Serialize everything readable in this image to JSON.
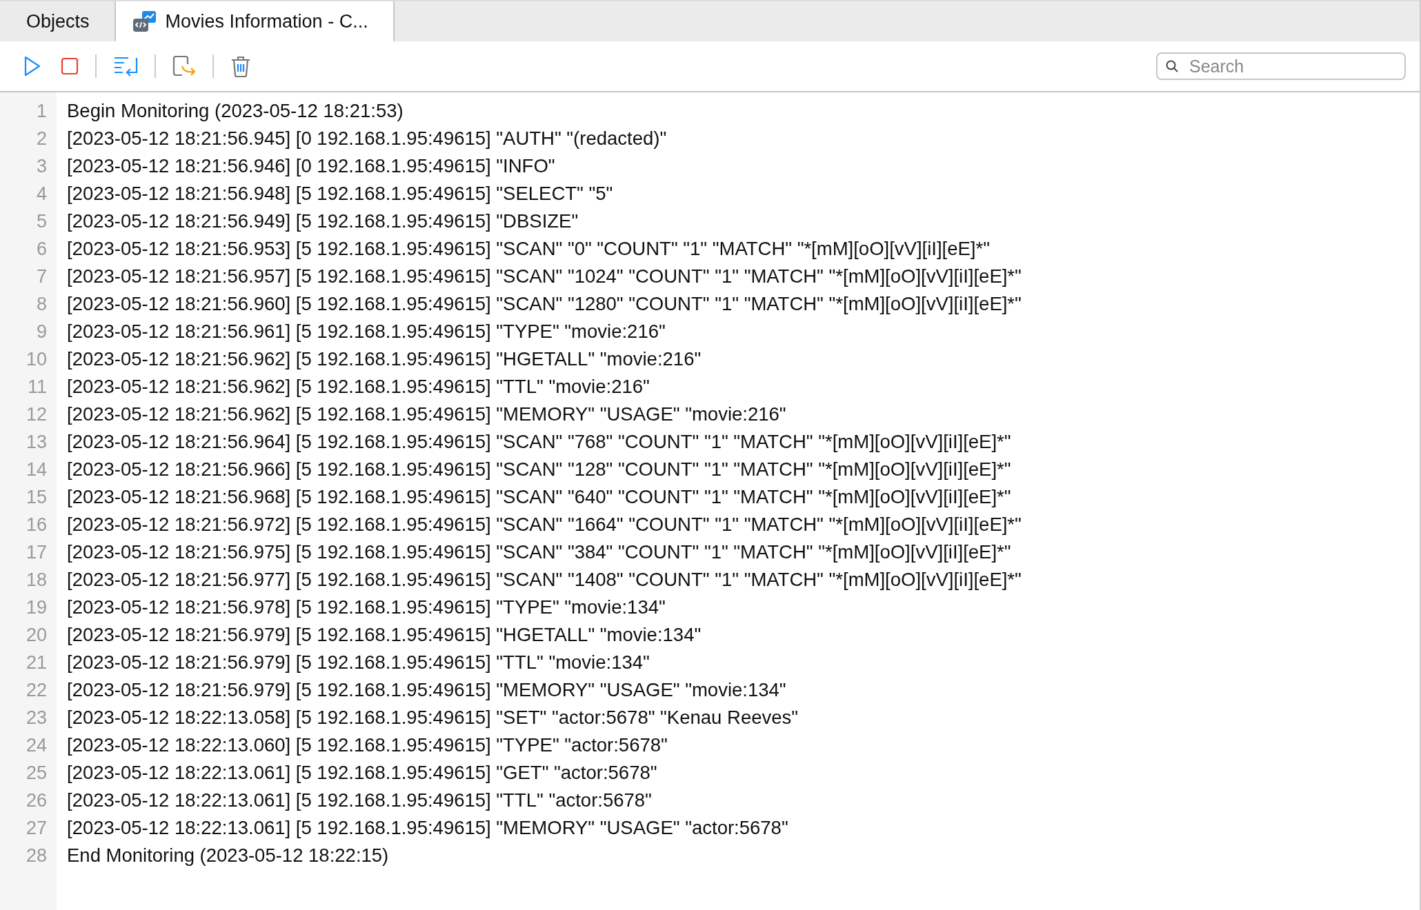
{
  "tabs": [
    {
      "label": "Objects",
      "selected": false,
      "kind": "plain"
    },
    {
      "label": "Movies Information - C...",
      "selected": true,
      "kind": "query"
    }
  ],
  "toolbar": {
    "search": {
      "placeholder": "Search"
    }
  },
  "log": {
    "lines": [
      {
        "number": "1",
        "text": "Begin Monitoring (2023-05-12 18:21:53)"
      },
      {
        "number": "2",
        "text": "[2023-05-12 18:21:56.945] [0 192.168.1.95:49615] \"AUTH\" \"(redacted)\""
      },
      {
        "number": "3",
        "text": "[2023-05-12 18:21:56.946] [0 192.168.1.95:49615] \"INFO\""
      },
      {
        "number": "4",
        "text": "[2023-05-12 18:21:56.948] [5 192.168.1.95:49615] \"SELECT\" \"5\""
      },
      {
        "number": "5",
        "text": "[2023-05-12 18:21:56.949] [5 192.168.1.95:49615] \"DBSIZE\""
      },
      {
        "number": "6",
        "text": "[2023-05-12 18:21:56.953] [5 192.168.1.95:49615] \"SCAN\" \"0\" \"COUNT\" \"1\" \"MATCH\" \"*[mM][oO][vV][iI][eE]*\""
      },
      {
        "number": "7",
        "text": "[2023-05-12 18:21:56.957] [5 192.168.1.95:49615] \"SCAN\" \"1024\" \"COUNT\" \"1\" \"MATCH\" \"*[mM][oO][vV][iI][eE]*\""
      },
      {
        "number": "8",
        "text": "[2023-05-12 18:21:56.960] [5 192.168.1.95:49615] \"SCAN\" \"1280\" \"COUNT\" \"1\" \"MATCH\" \"*[mM][oO][vV][iI][eE]*\""
      },
      {
        "number": "9",
        "text": "[2023-05-12 18:21:56.961] [5 192.168.1.95:49615] \"TYPE\" \"movie:216\""
      },
      {
        "number": "10",
        "text": "[2023-05-12 18:21:56.962] [5 192.168.1.95:49615] \"HGETALL\" \"movie:216\""
      },
      {
        "number": "11",
        "text": "[2023-05-12 18:21:56.962] [5 192.168.1.95:49615] \"TTL\" \"movie:216\""
      },
      {
        "number": "12",
        "text": "[2023-05-12 18:21:56.962] [5 192.168.1.95:49615] \"MEMORY\" \"USAGE\" \"movie:216\""
      },
      {
        "number": "13",
        "text": "[2023-05-12 18:21:56.964] [5 192.168.1.95:49615] \"SCAN\" \"768\" \"COUNT\" \"1\" \"MATCH\" \"*[mM][oO][vV][iI][eE]*\""
      },
      {
        "number": "14",
        "text": "[2023-05-12 18:21:56.966] [5 192.168.1.95:49615] \"SCAN\" \"128\" \"COUNT\" \"1\" \"MATCH\" \"*[mM][oO][vV][iI][eE]*\""
      },
      {
        "number": "15",
        "text": "[2023-05-12 18:21:56.968] [5 192.168.1.95:49615] \"SCAN\" \"640\" \"COUNT\" \"1\" \"MATCH\" \"*[mM][oO][vV][iI][eE]*\""
      },
      {
        "number": "16",
        "text": "[2023-05-12 18:21:56.972] [5 192.168.1.95:49615] \"SCAN\" \"1664\" \"COUNT\" \"1\" \"MATCH\" \"*[mM][oO][vV][iI][eE]*\""
      },
      {
        "number": "17",
        "text": "[2023-05-12 18:21:56.975] [5 192.168.1.95:49615] \"SCAN\" \"384\" \"COUNT\" \"1\" \"MATCH\" \"*[mM][oO][vV][iI][eE]*\""
      },
      {
        "number": "18",
        "text": "[2023-05-12 18:21:56.977] [5 192.168.1.95:49615] \"SCAN\" \"1408\" \"COUNT\" \"1\" \"MATCH\" \"*[mM][oO][vV][iI][eE]*\""
      },
      {
        "number": "19",
        "text": "[2023-05-12 18:21:56.978] [5 192.168.1.95:49615] \"TYPE\" \"movie:134\""
      },
      {
        "number": "20",
        "text": "[2023-05-12 18:21:56.979] [5 192.168.1.95:49615] \"HGETALL\" \"movie:134\""
      },
      {
        "number": "21",
        "text": "[2023-05-12 18:21:56.979] [5 192.168.1.95:49615] \"TTL\" \"movie:134\""
      },
      {
        "number": "22",
        "text": "[2023-05-12 18:21:56.979] [5 192.168.1.95:49615] \"MEMORY\" \"USAGE\" \"movie:134\""
      },
      {
        "number": "23",
        "text": "[2023-05-12 18:22:13.058] [5 192.168.1.95:49615] \"SET\" \"actor:5678\" \"Kenau Reeves\""
      },
      {
        "number": "24",
        "text": "[2023-05-12 18:22:13.060] [5 192.168.1.95:49615] \"TYPE\" \"actor:5678\""
      },
      {
        "number": "25",
        "text": "[2023-05-12 18:22:13.061] [5 192.168.1.95:49615] \"GET\" \"actor:5678\""
      },
      {
        "number": "26",
        "text": "[2023-05-12 18:22:13.061] [5 192.168.1.95:49615] \"TTL\" \"actor:5678\""
      },
      {
        "number": "27",
        "text": "[2023-05-12 18:22:13.061] [5 192.168.1.95:49615] \"MEMORY\" \"USAGE\" \"actor:5678\""
      },
      {
        "number": "28",
        "text": "End Monitoring (2023-05-12 18:22:15)"
      }
    ]
  }
}
